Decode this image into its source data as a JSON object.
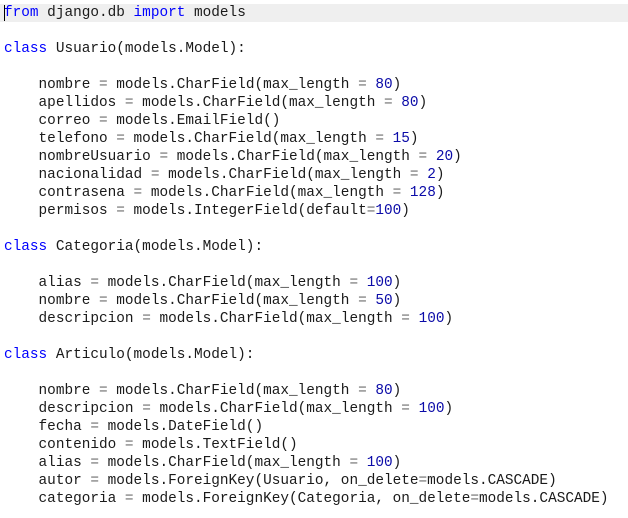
{
  "colors": {
    "keyword": "#0000ff",
    "operator": "#6e6e6e",
    "number": "#0b0ba8",
    "text": "#1a1a1a",
    "current_line_bg": "#efefef",
    "background": "#ffffff"
  },
  "editor": {
    "current_line": 0,
    "lines": [
      {
        "tokens": [
          {
            "t": "kw",
            "v": "from"
          },
          {
            "t": "id",
            "v": " django.db "
          },
          {
            "t": "kw",
            "v": "import"
          },
          {
            "t": "id",
            "v": " models"
          }
        ]
      },
      {
        "tokens": []
      },
      {
        "tokens": [
          {
            "t": "kw",
            "v": "class"
          },
          {
            "t": "id",
            "v": " Usuario(models.Model):"
          }
        ]
      },
      {
        "tokens": []
      },
      {
        "tokens": [
          {
            "t": "id",
            "v": "    nombre "
          },
          {
            "t": "op",
            "v": "="
          },
          {
            "t": "id",
            "v": " models.CharField(max_length "
          },
          {
            "t": "op",
            "v": "="
          },
          {
            "t": "id",
            "v": " "
          },
          {
            "t": "num",
            "v": "80"
          },
          {
            "t": "id",
            "v": ")"
          }
        ]
      },
      {
        "tokens": [
          {
            "t": "id",
            "v": "    apellidos "
          },
          {
            "t": "op",
            "v": "="
          },
          {
            "t": "id",
            "v": " models.CharField(max_length "
          },
          {
            "t": "op",
            "v": "="
          },
          {
            "t": "id",
            "v": " "
          },
          {
            "t": "num",
            "v": "80"
          },
          {
            "t": "id",
            "v": ")"
          }
        ]
      },
      {
        "tokens": [
          {
            "t": "id",
            "v": "    correo "
          },
          {
            "t": "op",
            "v": "="
          },
          {
            "t": "id",
            "v": " models.EmailField()"
          }
        ]
      },
      {
        "tokens": [
          {
            "t": "id",
            "v": "    telefono "
          },
          {
            "t": "op",
            "v": "="
          },
          {
            "t": "id",
            "v": " models.CharField(max_length "
          },
          {
            "t": "op",
            "v": "="
          },
          {
            "t": "id",
            "v": " "
          },
          {
            "t": "num",
            "v": "15"
          },
          {
            "t": "id",
            "v": ")"
          }
        ]
      },
      {
        "tokens": [
          {
            "t": "id",
            "v": "    nombreUsuario "
          },
          {
            "t": "op",
            "v": "="
          },
          {
            "t": "id",
            "v": " models.CharField(max_length "
          },
          {
            "t": "op",
            "v": "="
          },
          {
            "t": "id",
            "v": " "
          },
          {
            "t": "num",
            "v": "20"
          },
          {
            "t": "id",
            "v": ")"
          }
        ]
      },
      {
        "tokens": [
          {
            "t": "id",
            "v": "    nacionalidad "
          },
          {
            "t": "op",
            "v": "="
          },
          {
            "t": "id",
            "v": " models.CharField(max_length "
          },
          {
            "t": "op",
            "v": "="
          },
          {
            "t": "id",
            "v": " "
          },
          {
            "t": "num",
            "v": "2"
          },
          {
            "t": "id",
            "v": ")"
          }
        ]
      },
      {
        "tokens": [
          {
            "t": "id",
            "v": "    contrasena "
          },
          {
            "t": "op",
            "v": "="
          },
          {
            "t": "id",
            "v": " models.CharField(max_length "
          },
          {
            "t": "op",
            "v": "="
          },
          {
            "t": "id",
            "v": " "
          },
          {
            "t": "num",
            "v": "128"
          },
          {
            "t": "id",
            "v": ")"
          }
        ]
      },
      {
        "tokens": [
          {
            "t": "id",
            "v": "    permisos "
          },
          {
            "t": "op",
            "v": "="
          },
          {
            "t": "id",
            "v": " models.IntegerField(default"
          },
          {
            "t": "op",
            "v": "="
          },
          {
            "t": "num",
            "v": "100"
          },
          {
            "t": "id",
            "v": ")"
          }
        ]
      },
      {
        "tokens": []
      },
      {
        "tokens": [
          {
            "t": "kw",
            "v": "class"
          },
          {
            "t": "id",
            "v": " Categoria(models.Model):"
          }
        ]
      },
      {
        "tokens": []
      },
      {
        "tokens": [
          {
            "t": "id",
            "v": "    alias "
          },
          {
            "t": "op",
            "v": "="
          },
          {
            "t": "id",
            "v": " models.CharField(max_length "
          },
          {
            "t": "op",
            "v": "="
          },
          {
            "t": "id",
            "v": " "
          },
          {
            "t": "num",
            "v": "100"
          },
          {
            "t": "id",
            "v": ")"
          }
        ]
      },
      {
        "tokens": [
          {
            "t": "id",
            "v": "    nombre "
          },
          {
            "t": "op",
            "v": "="
          },
          {
            "t": "id",
            "v": " models.CharField(max_length "
          },
          {
            "t": "op",
            "v": "="
          },
          {
            "t": "id",
            "v": " "
          },
          {
            "t": "num",
            "v": "50"
          },
          {
            "t": "id",
            "v": ")"
          }
        ]
      },
      {
        "tokens": [
          {
            "t": "id",
            "v": "    descripcion "
          },
          {
            "t": "op",
            "v": "="
          },
          {
            "t": "id",
            "v": " models.CharField(max_length "
          },
          {
            "t": "op",
            "v": "="
          },
          {
            "t": "id",
            "v": " "
          },
          {
            "t": "num",
            "v": "100"
          },
          {
            "t": "id",
            "v": ")"
          }
        ]
      },
      {
        "tokens": []
      },
      {
        "tokens": [
          {
            "t": "kw",
            "v": "class"
          },
          {
            "t": "id",
            "v": " Articulo(models.Model):"
          }
        ]
      },
      {
        "tokens": []
      },
      {
        "tokens": [
          {
            "t": "id",
            "v": "    nombre "
          },
          {
            "t": "op",
            "v": "="
          },
          {
            "t": "id",
            "v": " models.CharField(max_length "
          },
          {
            "t": "op",
            "v": "="
          },
          {
            "t": "id",
            "v": " "
          },
          {
            "t": "num",
            "v": "80"
          },
          {
            "t": "id",
            "v": ")"
          }
        ]
      },
      {
        "tokens": [
          {
            "t": "id",
            "v": "    descripcion "
          },
          {
            "t": "op",
            "v": "="
          },
          {
            "t": "id",
            "v": " models.CharField(max_length "
          },
          {
            "t": "op",
            "v": "="
          },
          {
            "t": "id",
            "v": " "
          },
          {
            "t": "num",
            "v": "100"
          },
          {
            "t": "id",
            "v": ")"
          }
        ]
      },
      {
        "tokens": [
          {
            "t": "id",
            "v": "    fecha "
          },
          {
            "t": "op",
            "v": "="
          },
          {
            "t": "id",
            "v": " models.DateField()"
          }
        ]
      },
      {
        "tokens": [
          {
            "t": "id",
            "v": "    contenido "
          },
          {
            "t": "op",
            "v": "="
          },
          {
            "t": "id",
            "v": " models.TextField()"
          }
        ]
      },
      {
        "tokens": [
          {
            "t": "id",
            "v": "    alias "
          },
          {
            "t": "op",
            "v": "="
          },
          {
            "t": "id",
            "v": " models.CharField(max_length "
          },
          {
            "t": "op",
            "v": "="
          },
          {
            "t": "id",
            "v": " "
          },
          {
            "t": "num",
            "v": "100"
          },
          {
            "t": "id",
            "v": ")"
          }
        ]
      },
      {
        "tokens": [
          {
            "t": "id",
            "v": "    autor "
          },
          {
            "t": "op",
            "v": "="
          },
          {
            "t": "id",
            "v": " models.ForeignKey(Usuario, on_delete"
          },
          {
            "t": "op",
            "v": "="
          },
          {
            "t": "id",
            "v": "models.CASCADE)"
          }
        ]
      },
      {
        "tokens": [
          {
            "t": "id",
            "v": "    categoria "
          },
          {
            "t": "op",
            "v": "="
          },
          {
            "t": "id",
            "v": " models.ForeignKey(Categoria, on_delete"
          },
          {
            "t": "op",
            "v": "="
          },
          {
            "t": "id",
            "v": "models.CASCADE)"
          }
        ]
      }
    ]
  }
}
